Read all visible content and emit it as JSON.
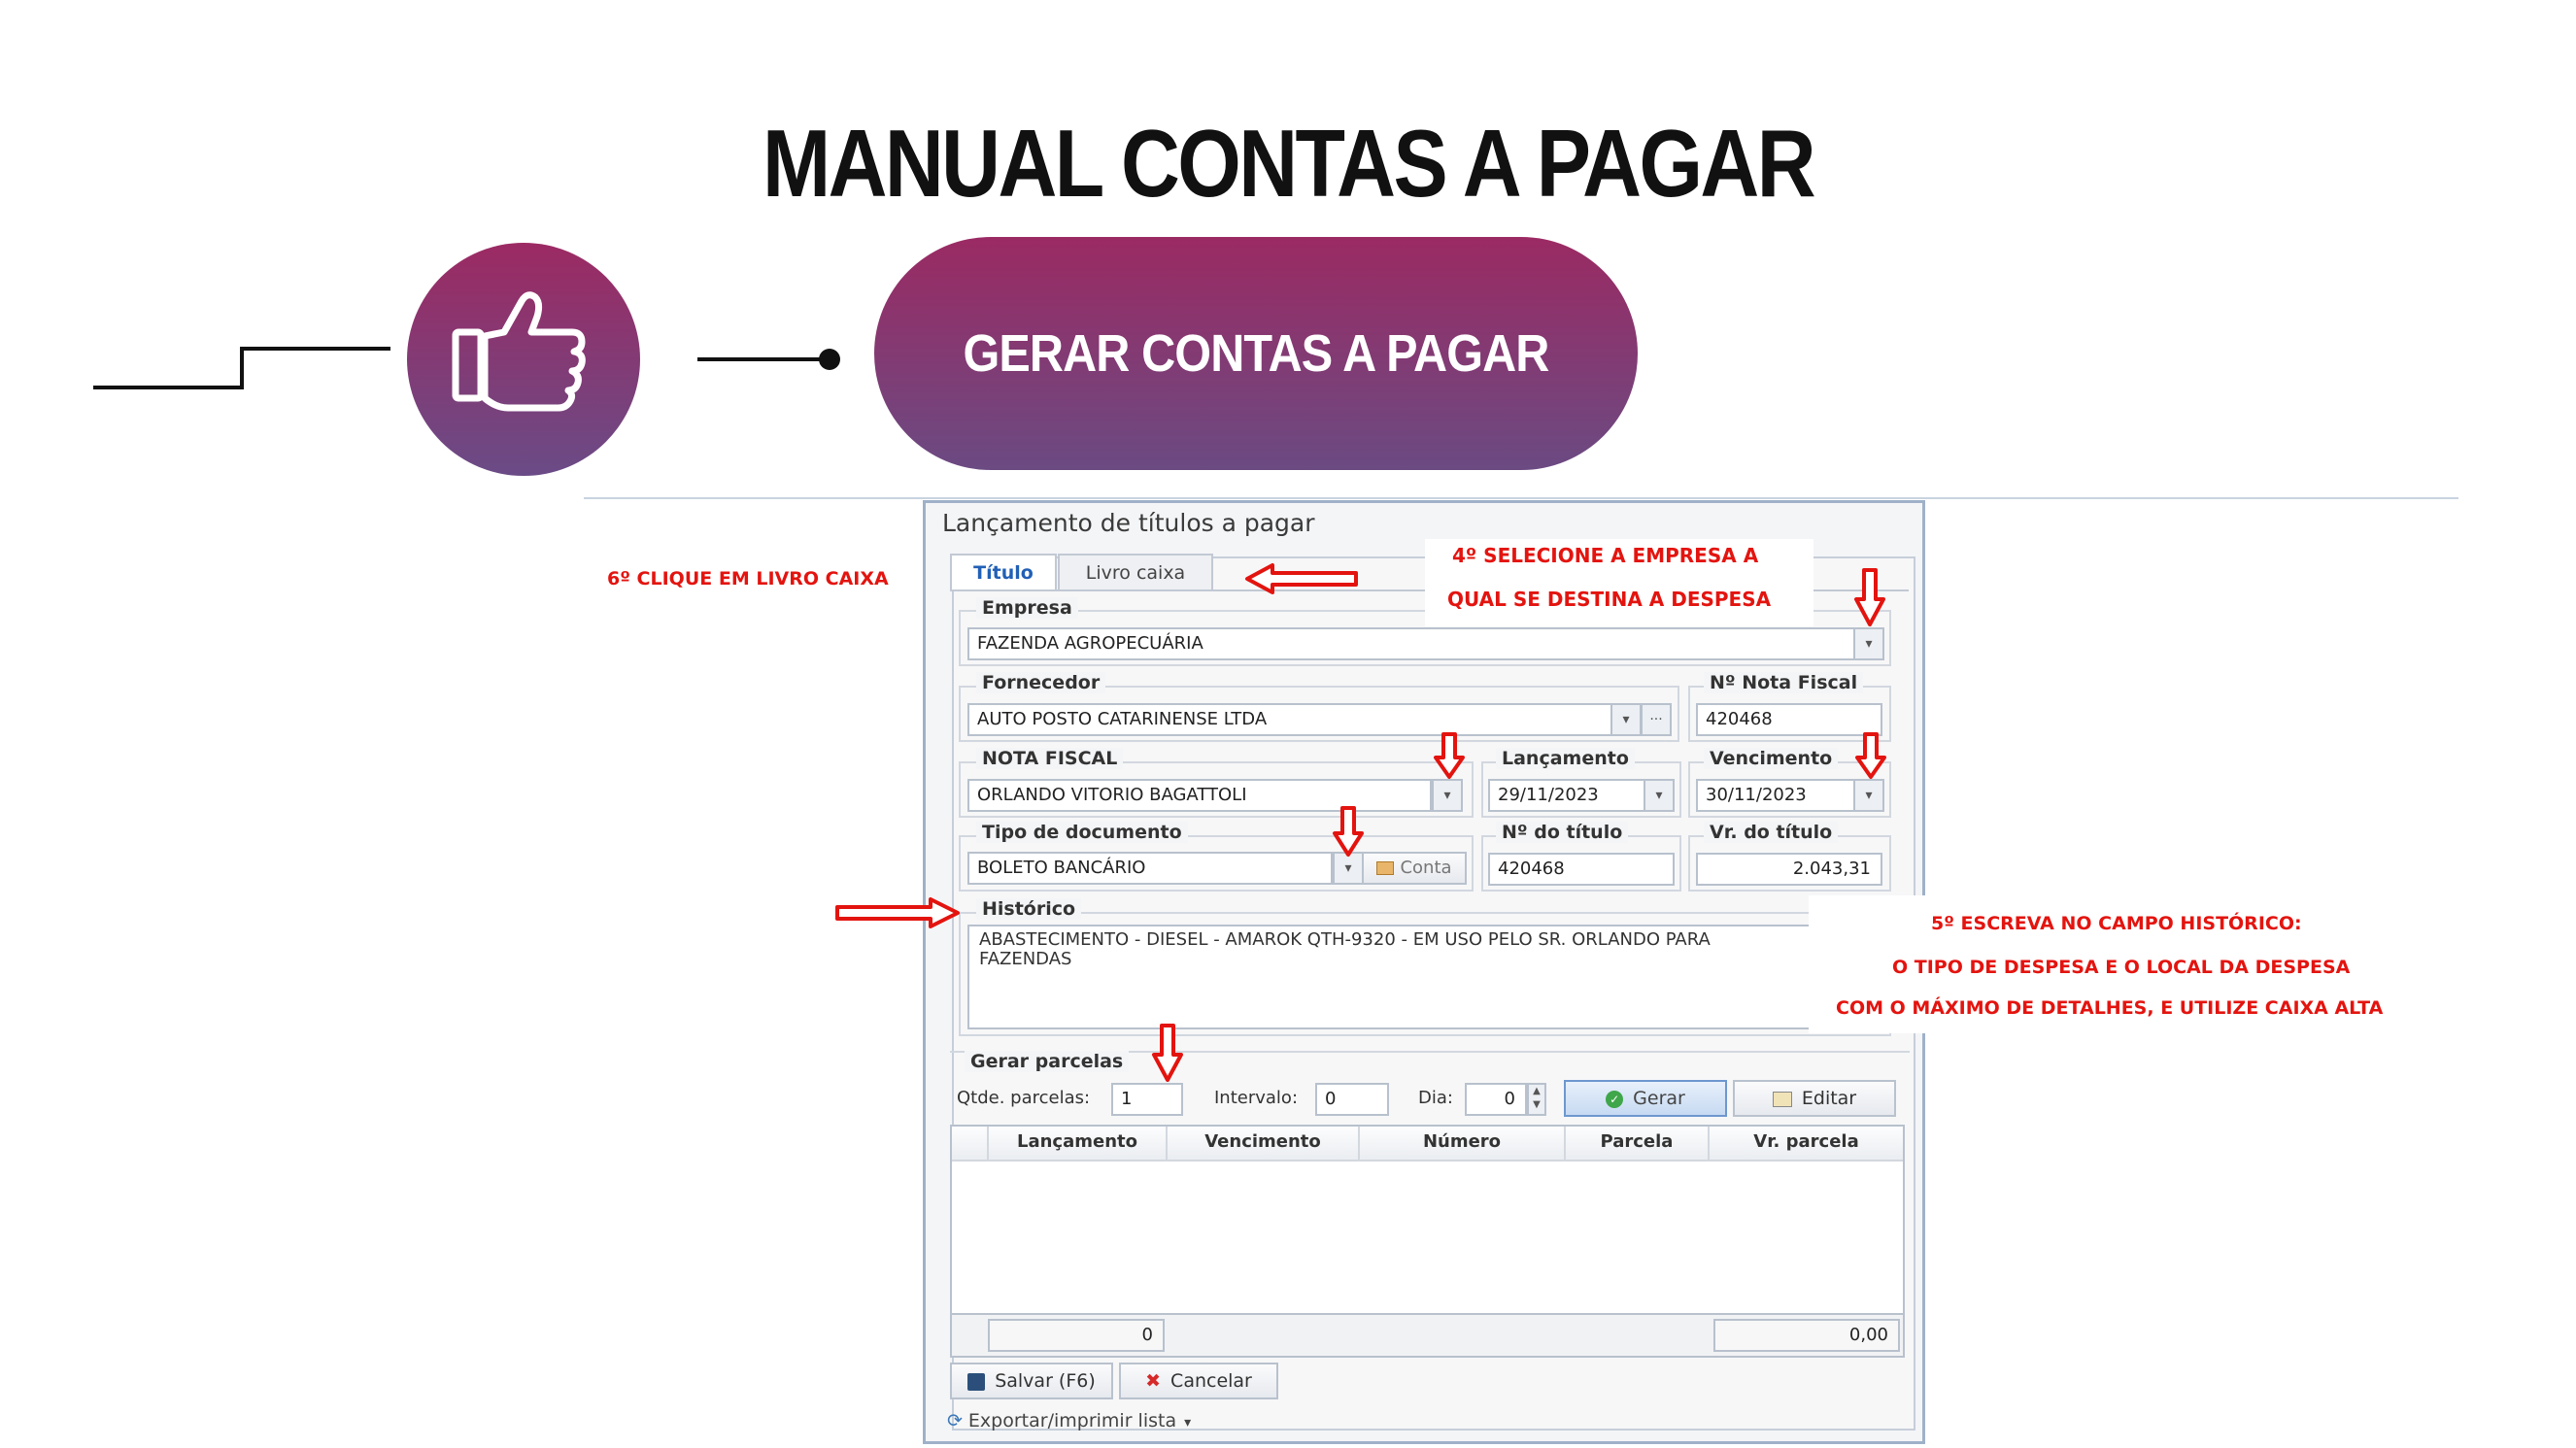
{
  "header": {
    "title": "MANUAL CONTAS A PAGAR",
    "step_label": "GERAR CONTAS A PAGAR"
  },
  "window": {
    "title": "Lançamento de títulos a pagar",
    "tabs": [
      {
        "label": "Título",
        "active": true
      },
      {
        "label": "Livro caixa",
        "active": false
      }
    ],
    "empresa": {
      "label": "Empresa",
      "value": "FAZENDA AGROPECUÁRIA"
    },
    "fornecedor": {
      "label": "Fornecedor",
      "value": "AUTO POSTO CATARINENSE LTDA"
    },
    "nota_fiscal_num": {
      "label": "Nº Nota Fiscal",
      "value": "420468"
    },
    "nota_fiscal": {
      "label": "NOTA FISCAL",
      "value": "ORLANDO VITORIO BAGATTOLI"
    },
    "lancamento": {
      "label": "Lançamento",
      "value": "29/11/2023"
    },
    "vencimento": {
      "label": "Vencimento",
      "value": "30/11/2023"
    },
    "tipo_documento": {
      "label": "Tipo de documento",
      "value": "BOLETO BANCÁRIO",
      "conta_button": "Conta"
    },
    "num_titulo": {
      "label": "Nº do título",
      "value": "420468"
    },
    "vr_titulo": {
      "label": "Vr. do título",
      "value": "2.043,31"
    },
    "historico": {
      "label": "Histórico",
      "value": "ABASTECIMENTO - DIESEL -  AMAROK QTH-9320 - EM USO PELO SR. ORLANDO PARA FAZENDAS"
    },
    "parcelas": {
      "label": "Gerar parcelas",
      "qtde_label": "Qtde. parcelas:",
      "qtde_value": "1",
      "intervalo_label": "Intervalo:",
      "intervalo_value": "0",
      "dia_label": "Dia:",
      "dia_value": "0",
      "gerar_button": "Gerar",
      "editar_button": "Editar"
    },
    "table": {
      "columns": [
        "Lançamento",
        "Vencimento",
        "Número",
        "Parcela",
        "Vr. parcela"
      ],
      "footer_count": "0",
      "footer_total": "0,00"
    },
    "actions": {
      "save": "Salvar (F6)",
      "cancel": "Cancelar",
      "export": "Exportar/imprimir lista"
    }
  },
  "annotations": {
    "step6": "6º CLIQUE EM LIVRO CAIXA",
    "step4_line1": "4º SELECIONE A EMPRESA A",
    "step4_line2": "QUAL SE DESTINA A DESPESA",
    "step5_line1": "5º ESCREVA NO CAMPO HISTÓRICO:",
    "step5_line2": "O TIPO DE DESPESA E O LOCAL DA DESPESA",
    "step5_line3": "COM O MÁXIMO DE DETALHES, E UTILIZE CAIXA ALTA"
  },
  "colors": {
    "brand_gradient_top": "#9b2a63",
    "brand_gradient_bottom": "#6b4a82",
    "annotation_red": "#e3140f",
    "active_tab_blue": "#2160b6"
  }
}
